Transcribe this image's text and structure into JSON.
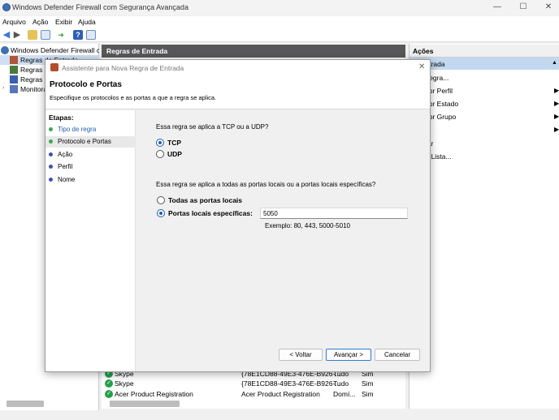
{
  "window": {
    "title": "Windows Defender Firewall com Segurança Avançada",
    "controls": {
      "minimize": "—",
      "maximize": "☐",
      "close": "✕"
    }
  },
  "menu": [
    "Arquivo",
    "Ação",
    "Exibir",
    "Ajuda"
  ],
  "toolbar": {
    "icons": [
      "back-icon",
      "forward-icon",
      "folder-up-icon",
      "show-hide-tree-icon",
      "export-icon",
      "help-icon",
      "properties-icon"
    ]
  },
  "tree": {
    "root": "Windows Defender Firewall com",
    "items": [
      "Regras de Entrada",
      "Regras d",
      "Regras d",
      "Monitora"
    ]
  },
  "center": {
    "header": "Regras de Entrada",
    "rows": [
      {
        "name": "Skype",
        "group": "{78E1CD88-49E3-476E-B926-...",
        "profile": "Tudo",
        "enabled": "Sim"
      },
      {
        "name": "Skype",
        "group": "{78E1CD88-49E3-476E-B926-...",
        "profile": "Tudo",
        "enabled": "Sim"
      },
      {
        "name": "Acer Product Registration",
        "group": "Acer Product Registration",
        "profile": "Domí...",
        "enabled": "Sim"
      }
    ]
  },
  "actions": {
    "header": "Ações",
    "subheader": "de Entrada",
    "items": [
      {
        "label": "ova Regra...",
        "submenu": false
      },
      {
        "label": "ltrar por Perfil",
        "submenu": true
      },
      {
        "label": "ltrar por Estado",
        "submenu": true
      },
      {
        "label": "ltrar por Grupo",
        "submenu": true
      },
      {
        "label": "ibir",
        "submenu": true
      },
      {
        "label": "tualizar",
        "submenu": false
      },
      {
        "label": "portar Lista...",
        "submenu": false
      },
      {
        "label": "uda",
        "submenu": false
      }
    ]
  },
  "dialog": {
    "title": "Assistente para Nova Regra de Entrada",
    "heading": "Protocolo e Portas",
    "subheading": "Especifique os protocolos e as portas a que a regra se aplica.",
    "steps_title": "Etapas:",
    "steps": [
      {
        "label": "Tipo de regra",
        "color": "#3aa655",
        "state": "done"
      },
      {
        "label": "Protocolo e Portas",
        "color": "#3aa655",
        "state": "current"
      },
      {
        "label": "Ação",
        "color": "#3f4fb5",
        "state": "pending"
      },
      {
        "label": "Perfil",
        "color": "#3f4fb5",
        "state": "pending"
      },
      {
        "label": "Nome",
        "color": "#3f4fb5",
        "state": "pending"
      }
    ],
    "protocol_question": "Essa regra se aplica a TCP ou a UDP?",
    "protocol_options": [
      {
        "label": "TCP",
        "checked": true
      },
      {
        "label": "UDP",
        "checked": false
      }
    ],
    "ports_question": "Essa regra se aplica a todas as portas locais ou a portas locais específicas?",
    "ports_options": [
      {
        "label": "Todas as portas locais",
        "checked": false
      },
      {
        "label": "Portas locais específicas:",
        "checked": true
      }
    ],
    "ports_value": "5050",
    "ports_example": "Exemplo: 80, 443, 5000-5010",
    "buttons": {
      "back": "< Voltar",
      "next": "Avançar >",
      "cancel": "Cancelar"
    }
  },
  "colors": {
    "accent": "#2f7bd0",
    "header_dark": "#58585a",
    "action_selected": "#c2d8f0"
  }
}
